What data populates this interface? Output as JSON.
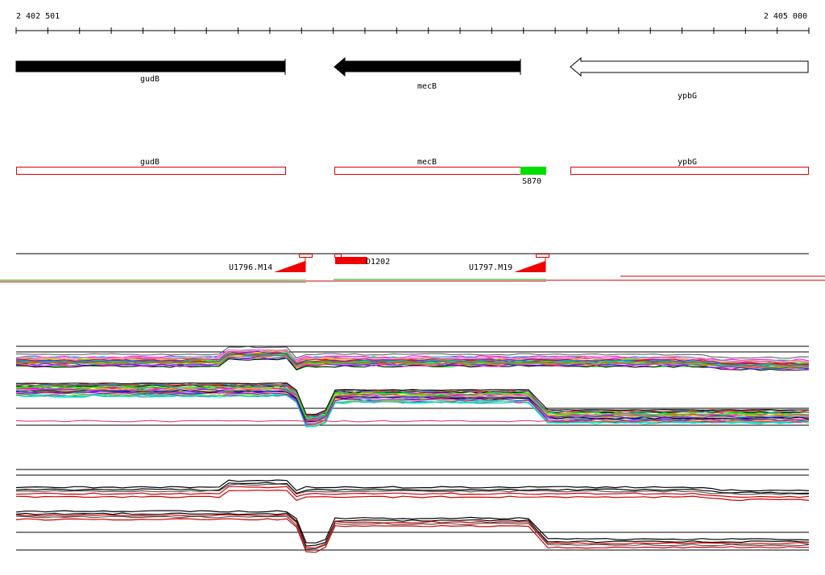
{
  "coords": {
    "start": "2 402 501",
    "end": "2 405 000"
  },
  "genes": [
    {
      "name": "gudB",
      "strand": "+",
      "fill": "#000000"
    },
    {
      "name": "mecB",
      "strand": "-",
      "fill": "#000000"
    },
    {
      "name": "ypbG",
      "strand": "-",
      "fill": "#ffffff"
    }
  ],
  "segments": [
    {
      "name": "gudB"
    },
    {
      "name": "mecB"
    },
    {
      "name": "ypbG"
    }
  ],
  "features": {
    "green_region": {
      "label": "S870",
      "color": "#00dd00"
    },
    "red_block": {
      "label": "D1202",
      "color": "#ee0000"
    },
    "terminators": [
      {
        "label": "U1796.M14",
        "color": "#ee0000"
      },
      {
        "label": "U1797.M19",
        "color": "#ee0000"
      }
    ]
  },
  "colors": {
    "axis": "#000000",
    "track_red": "#cc0000",
    "track_green": "#00aa00",
    "profile_palette": [
      "#ff00ff",
      "#00cccc",
      "#ffcc00",
      "#3333ff",
      "#00ff00",
      "#ff6600",
      "#9900cc",
      "#ff0000",
      "#0099ff",
      "#66cc00",
      "#cc6699",
      "#996633",
      "#ff99cc",
      "#00ff99",
      "#000000"
    ]
  }
}
